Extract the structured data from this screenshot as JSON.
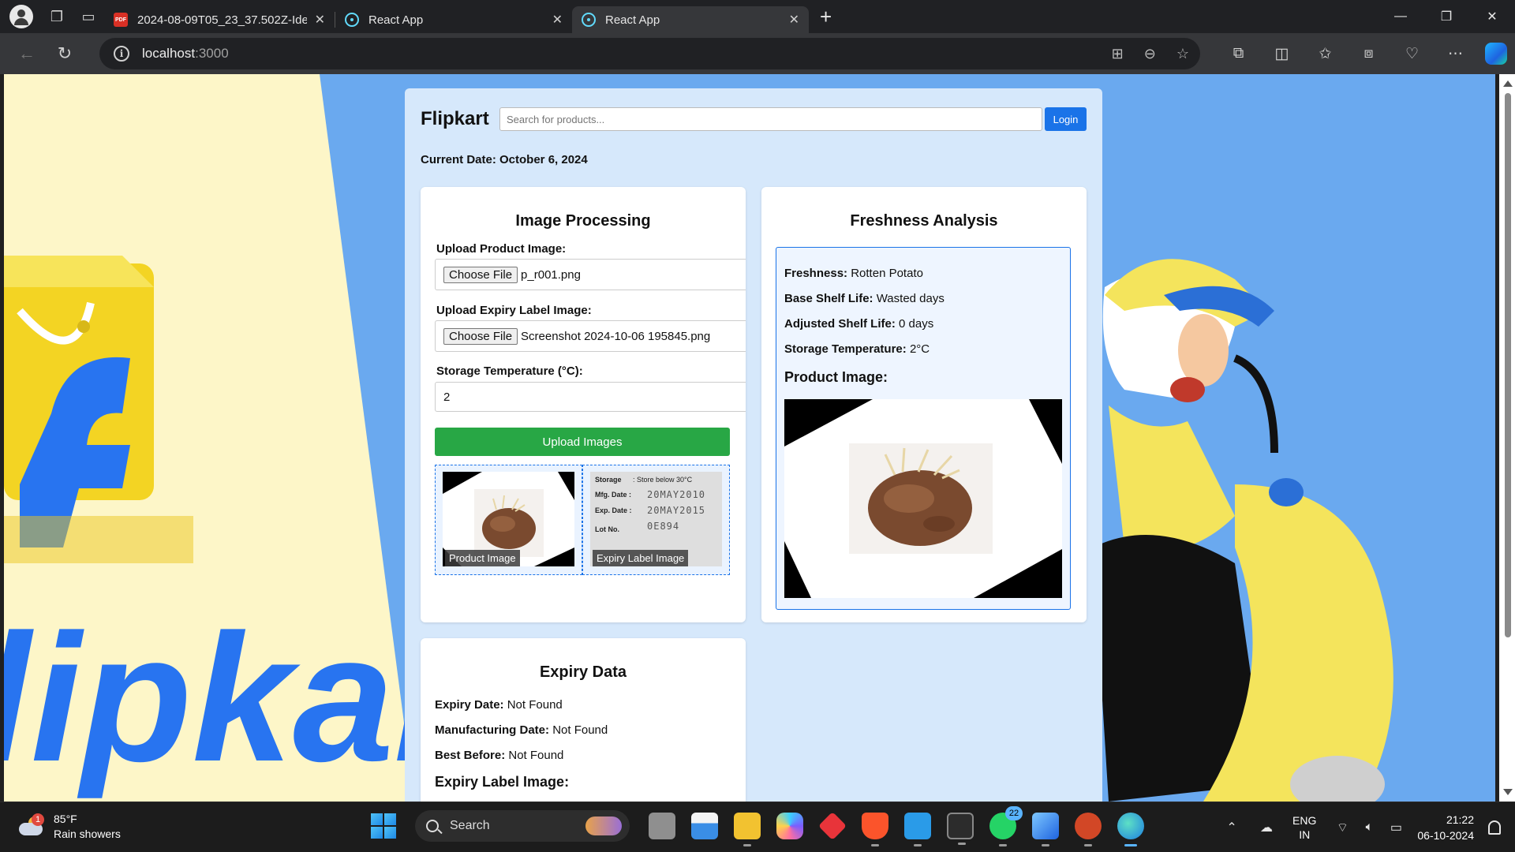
{
  "browser": {
    "tabs": [
      {
        "title": "2024-08-09T05_23_37.502Z-Idea",
        "favicon": "pdf-icon",
        "active": false
      },
      {
        "title": "React App",
        "favicon": "react-icon",
        "active": false
      },
      {
        "title": "React App",
        "favicon": "react-icon",
        "active": true
      }
    ],
    "url_host": "localhost",
    "url_port": ":3000"
  },
  "app": {
    "brand": "Flipkart",
    "search_placeholder": "Search for products...",
    "login_label": "Login",
    "current_date": "Current Date: October 6, 2024",
    "image_processing": {
      "title": "Image Processing",
      "product_label": "Upload Product Image:",
      "choose_label": "Choose File",
      "product_file": "p_r001.png",
      "expiry_label": "Upload Expiry Label Image:",
      "expiry_file": "Screenshot 2024-10-06 195845.png",
      "temp_label": "Storage Temperature (°C):",
      "temp_value": "2",
      "upload_button": "Upload Images",
      "thumb_product_caption": "Product Image",
      "thumb_expiry_caption": "Expiry Label Image",
      "label_text": {
        "storage": "Storage",
        "storage_value": ": Store below 30°C",
        "mfg": "Mfg. Date :",
        "mfg_value": "20MAY2010",
        "exp": "Exp. Date :",
        "exp_value": "20MAY2015",
        "lot": "Lot No.",
        "lot_value": "0E894"
      }
    },
    "freshness": {
      "title": "Freshness Analysis",
      "freshness_key": "Freshness:",
      "freshness_value": "Rotten Potato",
      "base_key": "Base Shelf Life:",
      "base_value": "Wasted days",
      "adjusted_key": "Adjusted Shelf Life:",
      "adjusted_value": "0 days",
      "storage_key": "Storage Temperature:",
      "storage_value": "2°C",
      "product_image_heading": "Product Image:"
    },
    "expiry": {
      "title": "Expiry Data",
      "expiry_key": "Expiry Date:",
      "expiry_value": "Not Found",
      "mfg_key": "Manufacturing Date:",
      "mfg_value": "Not Found",
      "best_key": "Best Before:",
      "best_value": "Not Found",
      "label_image_heading": "Expiry Label Image:"
    }
  },
  "taskbar": {
    "weather_badge": "1",
    "weather_temp": "85°F",
    "weather_desc": "Rain showers",
    "search_label": "Search",
    "whatsapp_badge": "22",
    "lang_line1": "ENG",
    "lang_line2": "IN",
    "time": "21:22",
    "date": "06-10-2024"
  },
  "colors": {
    "accent_blue": "#1a73e8",
    "upload_green": "#28a745",
    "app_bg": "#d6e8fb",
    "flipkart_blue": "#2874f0",
    "flipkart_yellow": "#f7d81c"
  }
}
